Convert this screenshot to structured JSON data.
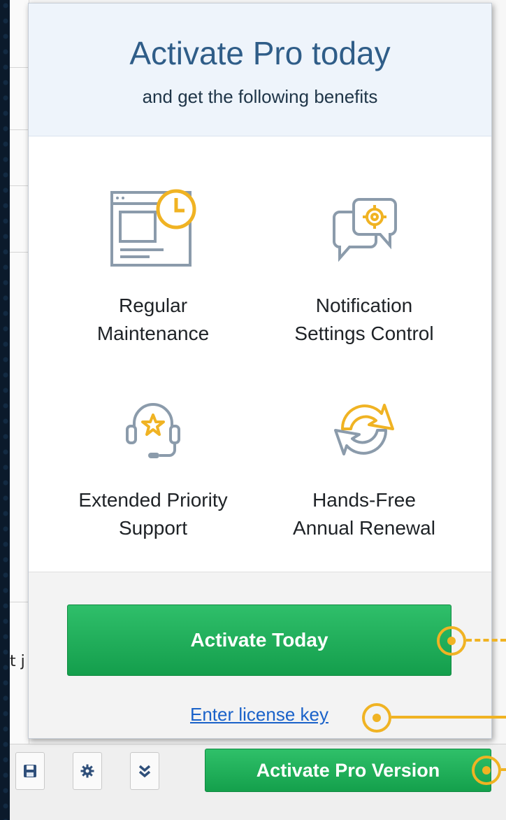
{
  "app": {
    "partial_text": "t j"
  },
  "popup": {
    "title": "Activate Pro today",
    "subtitle": "and get the following benefits",
    "benefits": [
      {
        "icon": "window-clock-icon",
        "line1": "Regular",
        "line2": "Maintenance"
      },
      {
        "icon": "chat-gear-icon",
        "line1": "Notification",
        "line2": "Settings Control"
      },
      {
        "icon": "headset-star-icon",
        "line1": "Extended Priority",
        "line2": "Support"
      },
      {
        "icon": "renewal-arrows-icon",
        "line1": "Hands-Free",
        "line2": "Annual Renewal"
      }
    ],
    "activate_button": "Activate Today",
    "license_link": "Enter license key"
  },
  "toolbar": {
    "icons": [
      "save-icon",
      "gear-icon",
      "chevron-double-down-icon"
    ],
    "pro_button": "Activate Pro Version"
  },
  "colors": {
    "accent_green": "#1aa953",
    "title_blue": "#2f5d88",
    "icon_orange": "#f0b323",
    "link_blue": "#1a62c9",
    "callout": "#f0b323"
  }
}
